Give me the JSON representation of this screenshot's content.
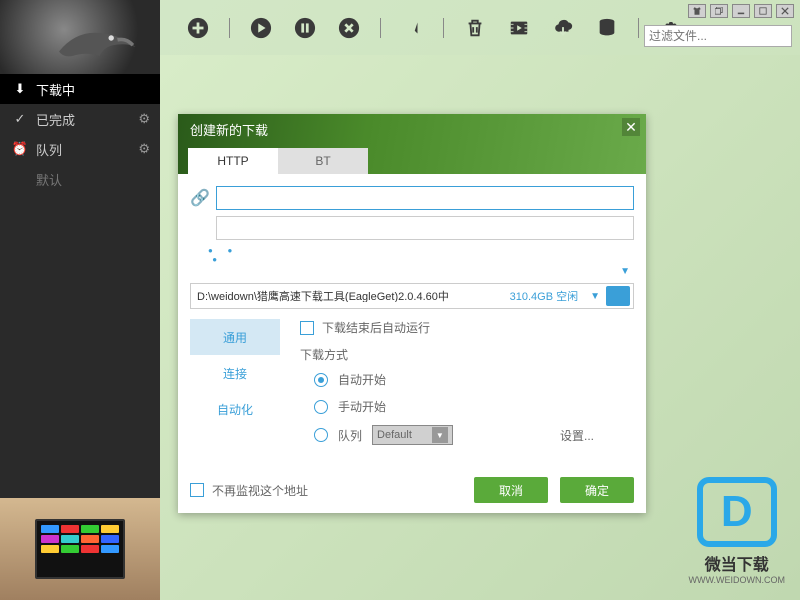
{
  "window": {
    "filter_placeholder": "过滤文件..."
  },
  "sidebar": {
    "items": [
      {
        "label": "下载中",
        "icon": "download"
      },
      {
        "label": "已完成",
        "icon": "check"
      },
      {
        "label": "队列",
        "icon": "clock"
      },
      {
        "label": "默认",
        "icon": ""
      }
    ]
  },
  "dialog": {
    "title": "创建新的下载",
    "tabs": {
      "http": "HTTP",
      "bt": "BT"
    },
    "url_value": "",
    "path_value": "D:\\weidown\\猎鹰高速下载工具(EagleGet)2.0.4.60中",
    "path_free": "310.4GB 空闲",
    "side_tabs": {
      "general": "通用",
      "connection": "连接",
      "automation": "自动化"
    },
    "auto_run_label": "下载结束后自动运行",
    "method_label": "下载方式",
    "radio_auto": "自动开始",
    "radio_manual": "手动开始",
    "radio_queue": "队列",
    "queue_default": "Default",
    "settings_link": "设置...",
    "monitor_label": "不再监视这个地址",
    "btn_cancel": "取消",
    "btn_ok": "确定"
  },
  "watermark": {
    "logo_letter": "D",
    "text": "微当下载",
    "url": "WWW.WEIDOWN.COM"
  }
}
